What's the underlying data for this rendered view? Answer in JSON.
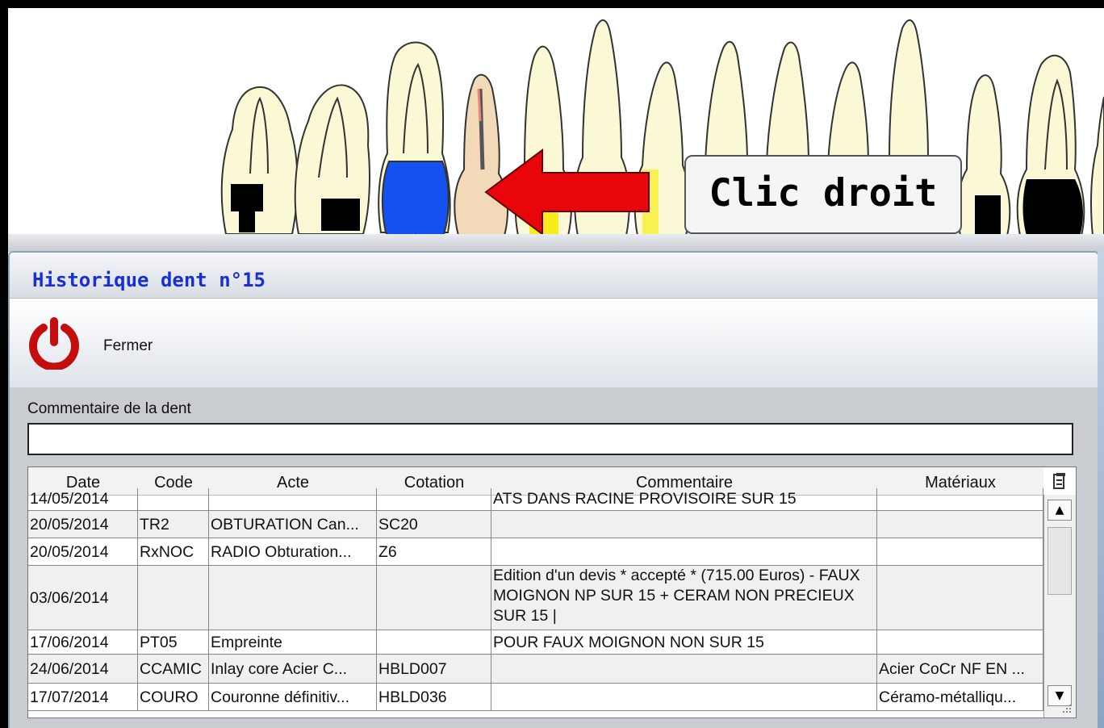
{
  "overlay": {
    "tooltip_text": "Clic droit"
  },
  "dialog": {
    "title": "Historique dent n°15",
    "close_label": "Fermer",
    "comment_label": "Commentaire de la dent",
    "comment_value": ""
  },
  "table": {
    "headers": [
      "Date",
      "Code",
      "Acte",
      "Cotation",
      "Commentaire",
      "Matériaux"
    ],
    "rows": [
      {
        "date": "14/05/2014",
        "code": "",
        "acte": "",
        "cotation": "",
        "commentaire": "ATS DANS RACINE PROVISOIRE SUR 15",
        "materiaux": ""
      },
      {
        "date": "20/05/2014",
        "code": "TR2",
        "acte": "OBTURATION Can...",
        "cotation": "SC20",
        "commentaire": "",
        "materiaux": ""
      },
      {
        "date": "20/05/2014",
        "code": "RxNOC",
        "acte": "RADIO Obturation...",
        "cotation": "Z6",
        "commentaire": "",
        "materiaux": ""
      },
      {
        "date": "03/06/2014",
        "code": "",
        "acte": "",
        "cotation": "",
        "commentaire": "Edition d'un devis * accepté *  (715.00 Euros) - FAUX MOIGNON NP SUR 15 + CERAM NON PRECIEUX SUR 15 |",
        "materiaux": ""
      },
      {
        "date": "17/06/2014",
        "code": "PT05",
        "acte": "Empreinte",
        "cotation": "",
        "commentaire": "POUR FAUX MOIGNON NON SUR 15",
        "materiaux": ""
      },
      {
        "date": "24/06/2014",
        "code": "CCAMIC",
        "acte": "Inlay core Acier C...",
        "cotation": "HBLD007",
        "commentaire": "",
        "materiaux": "Acier CoCr NF EN ..."
      },
      {
        "date": "17/07/2014",
        "code": "COURO",
        "acte": "Couronne définitiv...",
        "cotation": "HBLD036",
        "commentaire": "",
        "materiaux": "Céramo-métalliqu..."
      }
    ]
  },
  "colors": {
    "title": "#1a2fd0",
    "arrow": "#e8060a",
    "power": "#c40d0d",
    "filling_blue": "#1550f0",
    "filling_black": "#000000",
    "tooth_fill": "#fbf8d6"
  },
  "icons": [
    "power-icon",
    "arrow-left-icon",
    "column-chooser-icon",
    "scroll-up-icon",
    "scroll-down-icon",
    "resize-grip-icon"
  ]
}
